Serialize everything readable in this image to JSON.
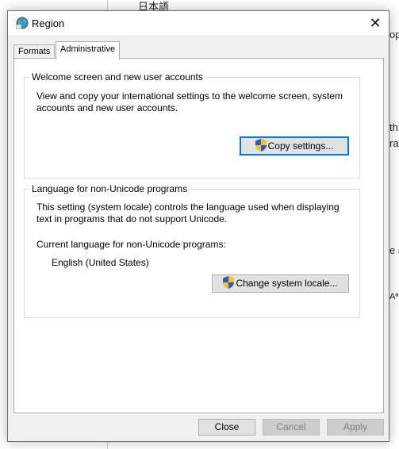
{
  "background": {
    "text_top": "日本語",
    "frag_1": "op",
    "frag_2": "th",
    "frag_3": "rag",
    "frag_4": "e a",
    "frag_5": "Aª"
  },
  "dialog": {
    "title": "Region",
    "title_icon": "globe-icon",
    "close_glyph": "✕"
  },
  "tabs": [
    {
      "label": "Formats",
      "active": false
    },
    {
      "label": "Administrative",
      "active": true
    }
  ],
  "welcome_group": {
    "title": "Welcome screen and new user accounts",
    "description_line1": "View and copy your international settings to the welcome screen, system",
    "description_line2": "accounts and new user accounts.",
    "button_label": "Copy settings..."
  },
  "locale_group": {
    "title": "Language for non-Unicode programs",
    "description_line1": "This setting (system locale) controls the language used when displaying",
    "description_line2": "text in programs that do not support Unicode.",
    "current_label": "Current language for non-Unicode programs:",
    "current_value": "English (United States)",
    "button_label": "Change system locale..."
  },
  "footer": {
    "close_label": "Close",
    "cancel_label": "Cancel",
    "apply_label": "Apply"
  },
  "colors": {
    "accent": "#0078d7",
    "dialog_bg": "#f0f0f0",
    "disabled_text": "#838383"
  }
}
